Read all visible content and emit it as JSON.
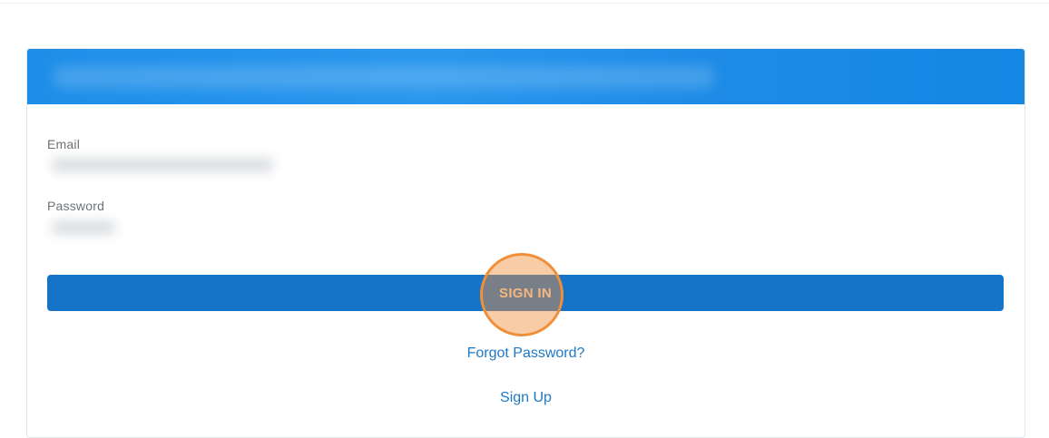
{
  "form": {
    "email_label": "Email",
    "password_label": "Password",
    "signin_label": "SIGN IN",
    "forgot_password_label": "Forgot Password?",
    "signup_label": "Sign Up"
  },
  "colors": {
    "header_blue": "#1e8ee8",
    "button_blue": "#1674c8",
    "link_blue": "#1e78c5",
    "highlight_orange": "#f08f3a"
  }
}
